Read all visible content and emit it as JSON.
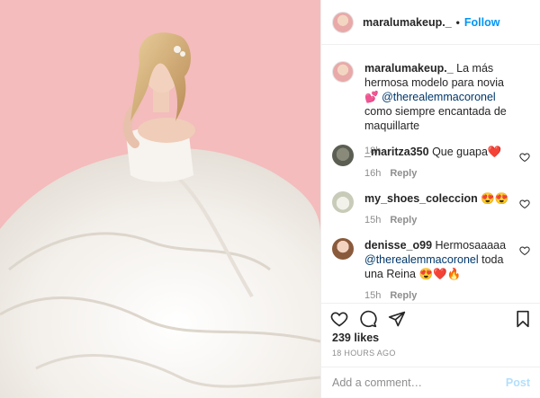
{
  "header": {
    "username": "maralumakeup._",
    "separator": "•",
    "follow_label": "Follow"
  },
  "caption": {
    "username": "maralumakeup._",
    "text": "La más hermosa modelo para novia 💕",
    "mention": "@therealemmacoronel",
    "text2": "como siempre encantada de maquillarte",
    "time": "18h"
  },
  "comments": [
    {
      "username": "_maritza350",
      "text": "Que guapa❤️",
      "time": "16h",
      "reply": "Reply"
    },
    {
      "username": "my_shoes_coleccion",
      "text": "😍😍",
      "time": "15h",
      "reply": "Reply"
    },
    {
      "username": "denisse_o99",
      "text": "Hermosaaaaa",
      "mention": "@therealemmacoronel",
      "text2": "toda una Reina 😍❤️🔥",
      "time": "15h",
      "reply": "Reply"
    }
  ],
  "likes": "239 likes",
  "posted": "18 HOURS AGO",
  "add_comment": {
    "placeholder": "Add a comment…",
    "post_label": "Post"
  },
  "icons": {
    "like": "heart-icon",
    "comment": "comment-icon",
    "share": "share-icon",
    "save": "bookmark-icon"
  },
  "colors": {
    "accent": "#0095f6",
    "background_photo": "#f4bcbc"
  }
}
